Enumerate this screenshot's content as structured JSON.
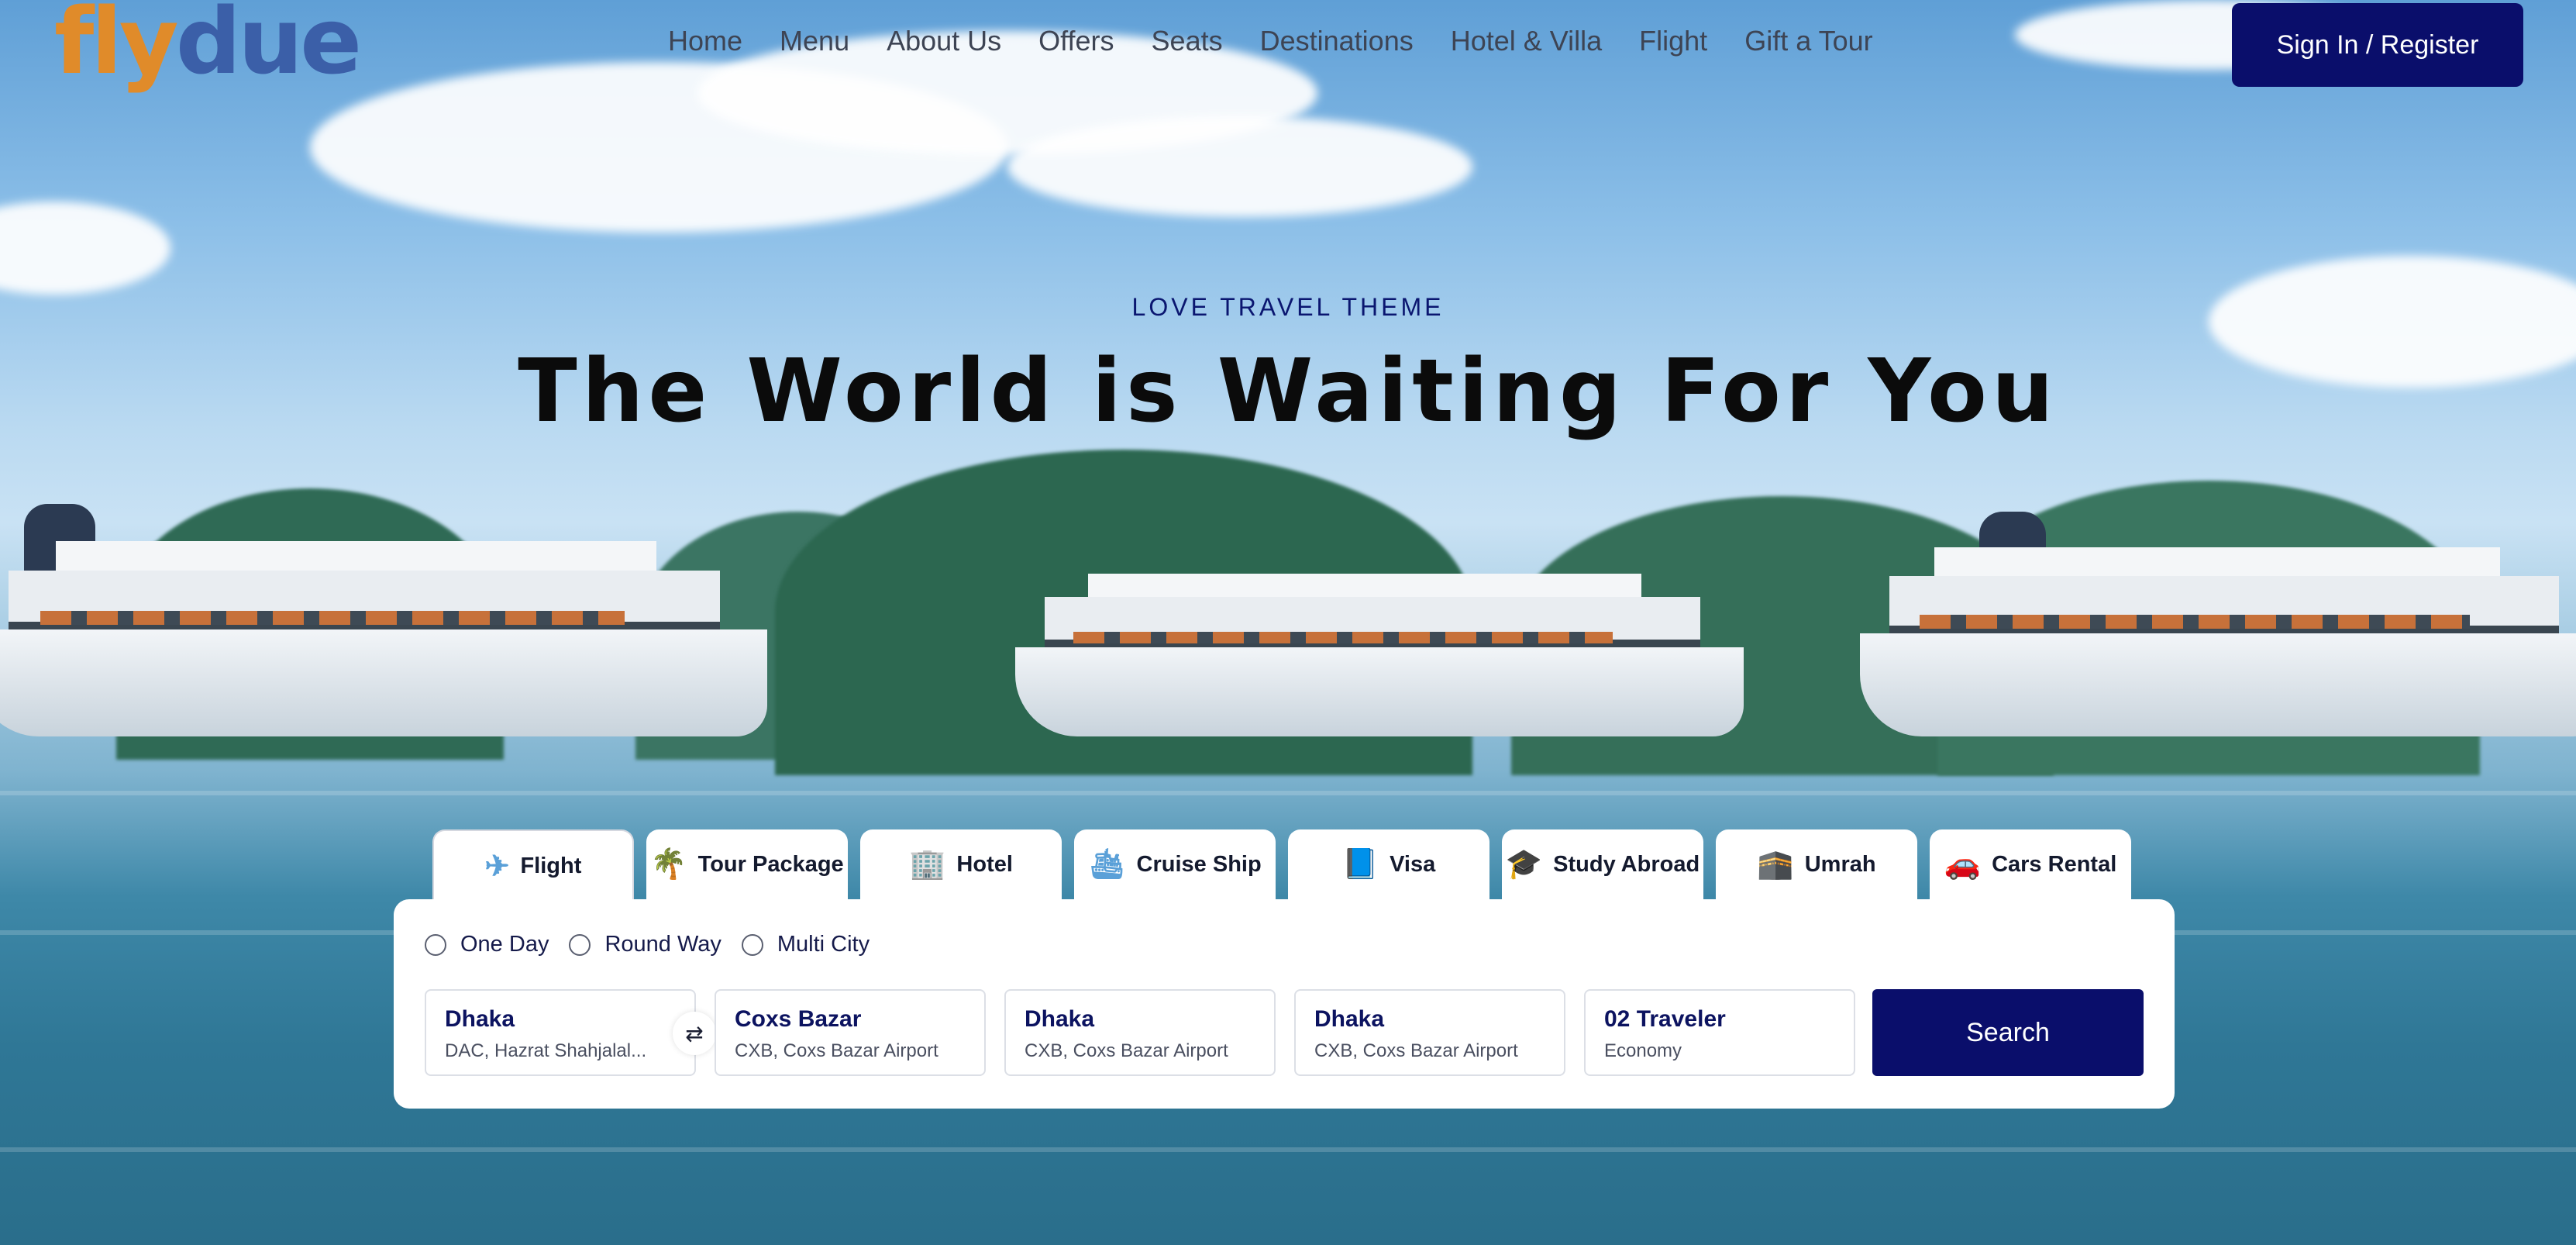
{
  "brand": {
    "logo_part1": "fly",
    "logo_part2": "due"
  },
  "nav": {
    "items": [
      "Home",
      "Menu",
      "About Us",
      "Offers",
      "Seats",
      "Destinations",
      "Hotel & Villa",
      "Flight",
      "Gift a Tour"
    ],
    "signin_label": "Sign In / Register"
  },
  "hero": {
    "eyebrow": "LOVE TRAVEL THEME",
    "headline": "The World is Waiting For You"
  },
  "tabs": [
    {
      "label": "Flight",
      "icon": "airplane-icon"
    },
    {
      "label": "Tour Package",
      "icon": "palm-tree-icon"
    },
    {
      "label": "Hotel",
      "icon": "hotel-building-icon"
    },
    {
      "label": "Cruise Ship",
      "icon": "cruise-ship-icon"
    },
    {
      "label": "Visa",
      "icon": "visa-document-icon"
    },
    {
      "label": "Study Abroad",
      "icon": "graduation-cap-icon"
    },
    {
      "label": "Umrah",
      "icon": "kaaba-icon"
    },
    {
      "label": "Cars Rental",
      "icon": "car-icon"
    }
  ],
  "trip_types": [
    "One Day",
    "Round Way",
    "Multi City"
  ],
  "search": {
    "from": {
      "city": "Dhaka",
      "airport": "DAC, Hazrat Shahjalal..."
    },
    "to": {
      "city": "Coxs Bazar",
      "airport": "CXB, Coxs Bazar Airport"
    },
    "depart": {
      "city": "Dhaka",
      "airport": "CXB, Coxs Bazar Airport"
    },
    "return": {
      "city": "Dhaka",
      "airport": "CXB, Coxs Bazar Airport"
    },
    "travelers": {
      "count": "02 Traveler",
      "class": "Economy"
    },
    "button_label": "Search"
  },
  "colors": {
    "primary": "#0a0e6b",
    "logo_orange": "#e08b2a",
    "logo_blue": "#3b5fa8"
  }
}
